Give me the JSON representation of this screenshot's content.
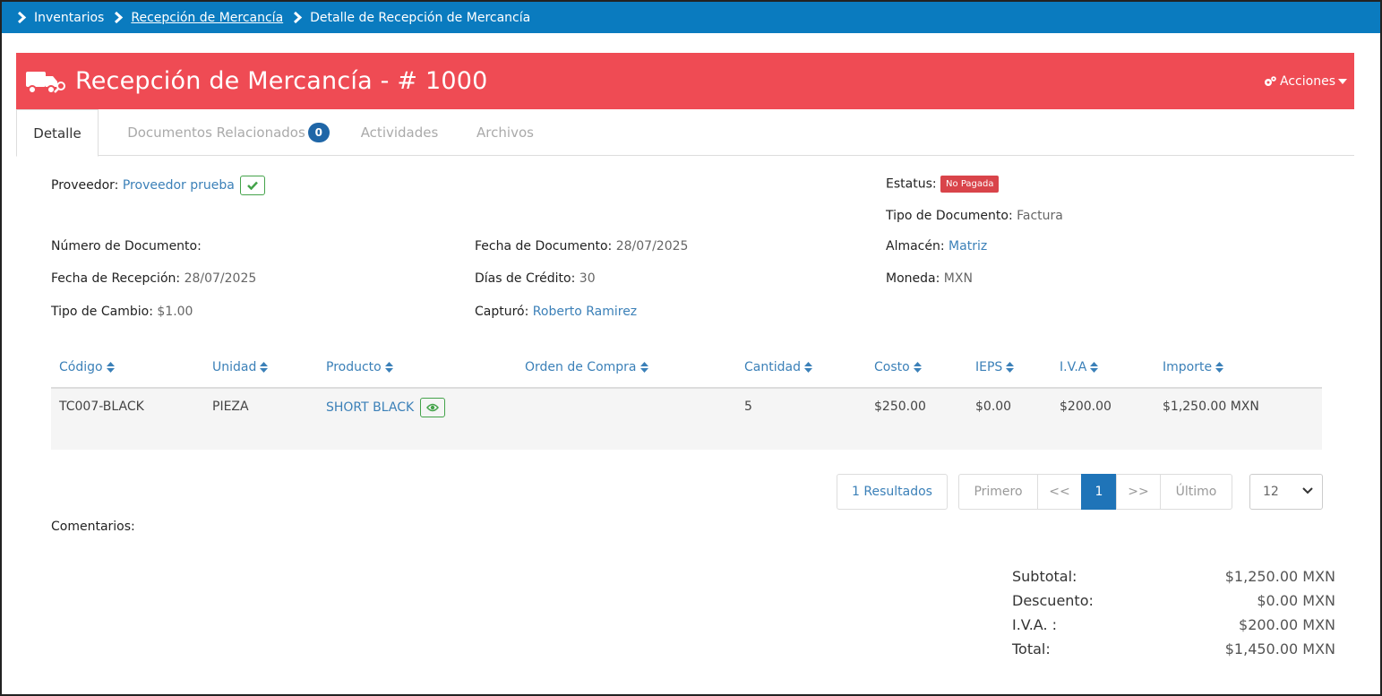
{
  "breadcrumb": {
    "items": [
      {
        "label": "Inventarios"
      },
      {
        "label": "Recepción de Mercancía"
      },
      {
        "label": "Detalle de Recepción de Mercancía"
      }
    ]
  },
  "header": {
    "title": "Recepción de Mercancía - # 1000",
    "actions_label": "Acciones",
    "icon": "truck-icon",
    "background_color": "#ef4b54"
  },
  "tabs": [
    {
      "label": "Detalle",
      "active": true
    },
    {
      "label": "Documentos Relacionados",
      "badge": "0"
    },
    {
      "label": "Actividades"
    },
    {
      "label": "Archivos"
    }
  ],
  "details": {
    "proveedor": {
      "label": "Proveedor:",
      "value": "Proveedor prueba"
    },
    "estatus": {
      "label": "Estatus:",
      "value": "No Pagada"
    },
    "tipo_documento": {
      "label": "Tipo de Documento:",
      "value": "Factura"
    },
    "numero_documento": {
      "label": "Número de Documento:",
      "value": ""
    },
    "fecha_documento": {
      "label": "Fecha de Documento:",
      "value": "28/07/2025"
    },
    "almacen": {
      "label": "Almacén:",
      "value": "Matriz"
    },
    "fecha_recepcion": {
      "label": "Fecha de Recepción:",
      "value": "28/07/2025"
    },
    "dias_credito": {
      "label": "Días de Crédito:",
      "value": "30"
    },
    "moneda": {
      "label": "Moneda:",
      "value": "MXN"
    },
    "tipo_cambio": {
      "label": "Tipo de Cambio:",
      "value": "$1.00"
    },
    "capturo": {
      "label": "Capturó:",
      "value": "Roberto Ramirez"
    }
  },
  "table": {
    "columns": [
      "Código",
      "Unidad",
      "Producto",
      "Orden de Compra",
      "Cantidad",
      "Costo",
      "IEPS",
      "I.V.A",
      "Importe"
    ],
    "rows": [
      {
        "codigo": "TC007-BLACK",
        "unidad": "PIEZA",
        "producto": "SHORT BLACK",
        "orden": "",
        "cantidad": "5",
        "costo": "$250.00",
        "ieps": "$0.00",
        "iva": "$200.00",
        "importe": "$1,250.00 MXN"
      }
    ]
  },
  "pagination": {
    "results": "1 Resultados",
    "first": "Primero",
    "prev": "<<",
    "current": "1",
    "next": ">>",
    "last": "Último",
    "page_size": "12"
  },
  "comentarios_label": "Comentarios:",
  "totals": {
    "subtotal": {
      "label": "Subtotal:",
      "value": "$1,250.00 MXN"
    },
    "descuento": {
      "label": "Descuento:",
      "value": "$0.00 MXN"
    },
    "iva": {
      "label": "I.V.A. :",
      "value": "$200.00 MXN"
    },
    "total": {
      "label": "Total:",
      "value": "$1,450.00 MXN"
    }
  },
  "colors": {
    "topbar": "#0a7bbf",
    "header": "#ef4b54",
    "link": "#3b80b8",
    "status_badge": "#d9444a",
    "success": "#44a34a"
  }
}
